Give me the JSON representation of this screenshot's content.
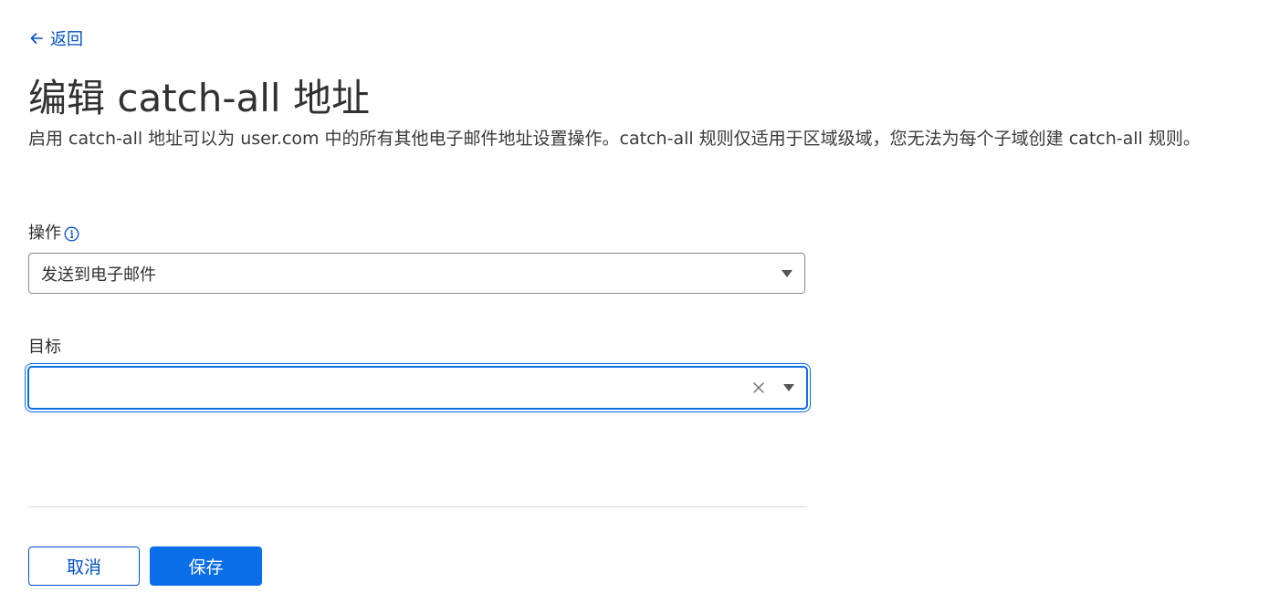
{
  "back": {
    "label": "返回"
  },
  "page": {
    "title": "编辑 catch-all 地址",
    "description": "启用 catch-all 地址可以为 user.com 中的所有其他电子邮件地址设置操作。catch-all 规则仅适用于区域级域，您无法为每个子域创建 catch-all 规则。"
  },
  "form": {
    "action": {
      "label": "操作",
      "selected": "发送到电子邮件"
    },
    "target": {
      "label": "目标",
      "selected": ""
    }
  },
  "buttons": {
    "cancel": "取消",
    "save": "保存"
  },
  "colors": {
    "link": "#0051c3",
    "primary": "#0a6ee8",
    "focus_ring": "#0a6ee8",
    "text": "#313131"
  },
  "icons": {
    "back": "arrow-left-icon",
    "info": "info-icon",
    "clear": "close-icon",
    "dropdown": "caret-down-icon"
  }
}
